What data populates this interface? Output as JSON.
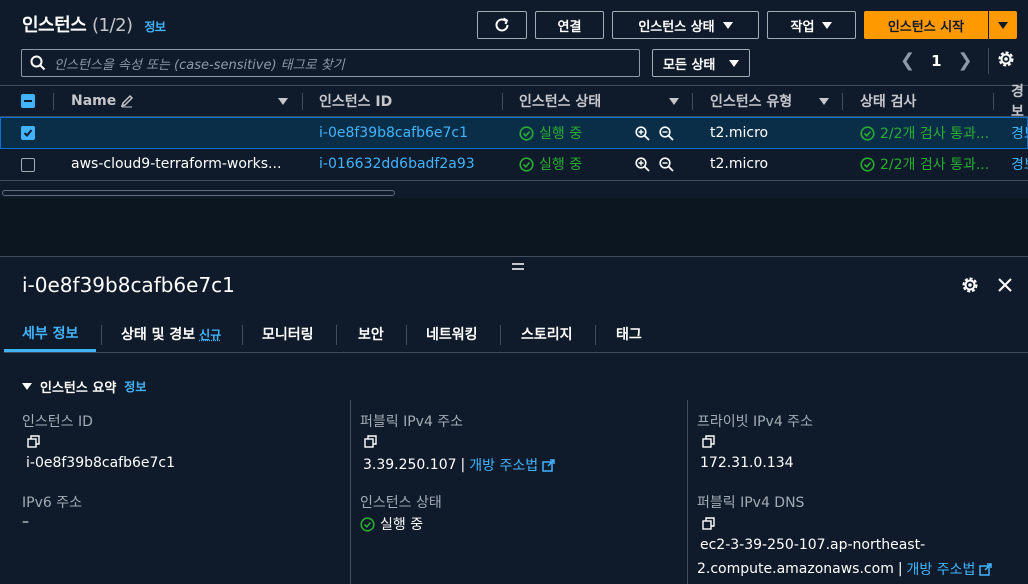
{
  "header": {
    "title": "인스턴스",
    "count": "(1/2)",
    "info": "정보",
    "connect_label": "연결",
    "instance_state_label": "인스턴스 상태",
    "actions_label": "작업",
    "launch_label": "인스턴스 시작"
  },
  "search": {
    "placeholder": "인스턴스을 속성 또는 (case-sensitive) 태그로 찾기"
  },
  "filter": {
    "state_select": "모든 상태"
  },
  "pagination": {
    "page": "1"
  },
  "table": {
    "columns": [
      "Name",
      "인스턴스 ID",
      "인스턴스 상태",
      "인스턴스 유형",
      "상태 검사",
      "경보"
    ],
    "rows": [
      {
        "name": "",
        "instance_id": "i-0e8f39b8cafb6e7c1",
        "state": "실행 중",
        "type": "t2.micro",
        "check": "2/2개 검사 통과...",
        "alarm": "경보",
        "selected": true
      },
      {
        "name": "aws-cloud9-terraform-works...",
        "instance_id": "i-016632dd6badf2a93",
        "state": "실행 중",
        "type": "t2.micro",
        "check": "2/2개 검사 통과...",
        "alarm": "경보",
        "selected": false
      }
    ]
  },
  "detail": {
    "title": "i-0e8f39b8cafb6e7c1",
    "tabs": [
      {
        "label": "세부 정보"
      },
      {
        "label": "상태 및 경보",
        "badge": "신규"
      },
      {
        "label": "모니터링"
      },
      {
        "label": "보안"
      },
      {
        "label": "네트워킹"
      },
      {
        "label": "스토리지"
      },
      {
        "label": "태그"
      }
    ],
    "section_title": "인스턴스 요약",
    "section_info": "정보",
    "fields": {
      "instance_id_label": "인스턴스 ID",
      "instance_id_value": "i-0e8f39b8cafb6e7c1",
      "public_ipv4_label": "퍼블릭 IPv4 주소",
      "public_ipv4_value": "3.39.250.107",
      "open_address_label": "개방 주소법",
      "private_ipv4_label": "프라이빗 IPv4 주소",
      "private_ipv4_value": "172.31.0.134",
      "ipv6_label": "IPv6 주소",
      "ipv6_value": "–",
      "instance_state_label": "인스턴스 상태",
      "instance_state_value": "실행 중",
      "public_dns_label": "퍼블릭 IPv4 DNS",
      "public_dns_line1": "ec2-3-39-250-107.ap-northeast-",
      "public_dns_line2": "2.compute.amazonaws.com",
      "dns_open_address_label": "개방 주소법"
    }
  },
  "colors": {
    "background": "#0f1b2a",
    "accent": "#42b4ff",
    "primary_button": "#ff9900",
    "success": "#29ad32",
    "border": "#414d5c"
  }
}
